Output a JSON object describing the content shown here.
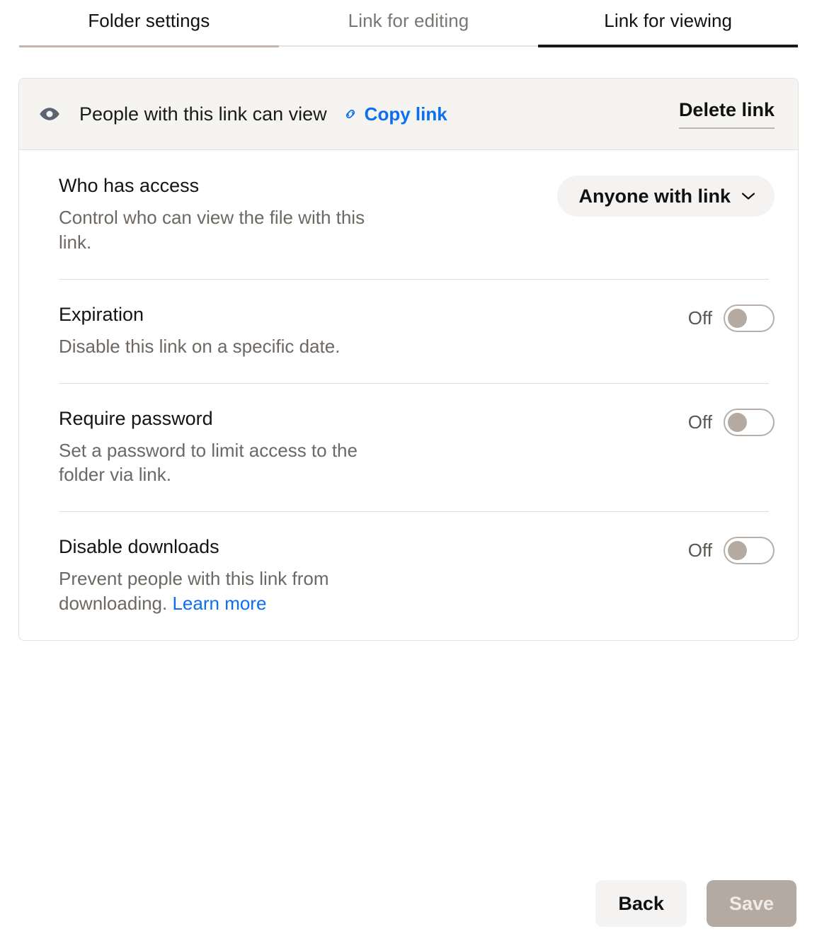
{
  "tabs": [
    {
      "label": "Folder settings",
      "state": "first"
    },
    {
      "label": "Link for editing",
      "state": "muted"
    },
    {
      "label": "Link for viewing",
      "state": "active"
    }
  ],
  "card": {
    "header": {
      "eye_icon": "eye-icon",
      "title": "People with this link can view",
      "link_icon": "link-icon",
      "copy_link": "Copy link",
      "delete_link": "Delete link"
    },
    "rows": [
      {
        "title": "Who has access",
        "desc": "Control who can view the file with this link.",
        "control": "dropdown",
        "value": "Anyone with link",
        "chevron": "chevron-down-icon"
      },
      {
        "title": "Expiration",
        "desc": "Disable this link on a specific date.",
        "control": "toggle",
        "state": "Off"
      },
      {
        "title": "Require password",
        "desc": "Set a password to limit access to the folder via link.",
        "control": "toggle",
        "state": "Off"
      },
      {
        "title": "Disable downloads",
        "desc_before": "Prevent people with this link from downloading. ",
        "desc_link": "Learn more",
        "control": "toggle",
        "state": "Off"
      }
    ]
  },
  "footer": {
    "back_label": "Back",
    "save_label": "Save"
  },
  "colors": {
    "accent_blue": "#0c6ff2",
    "active_tab_rule": "#1a1a1a",
    "first_tab_rule": "#c2b6ae",
    "header_bg": "#f5f4f0",
    "toggle_knob": "#b5aaa2",
    "save_bg": "#b5aaa2"
  }
}
